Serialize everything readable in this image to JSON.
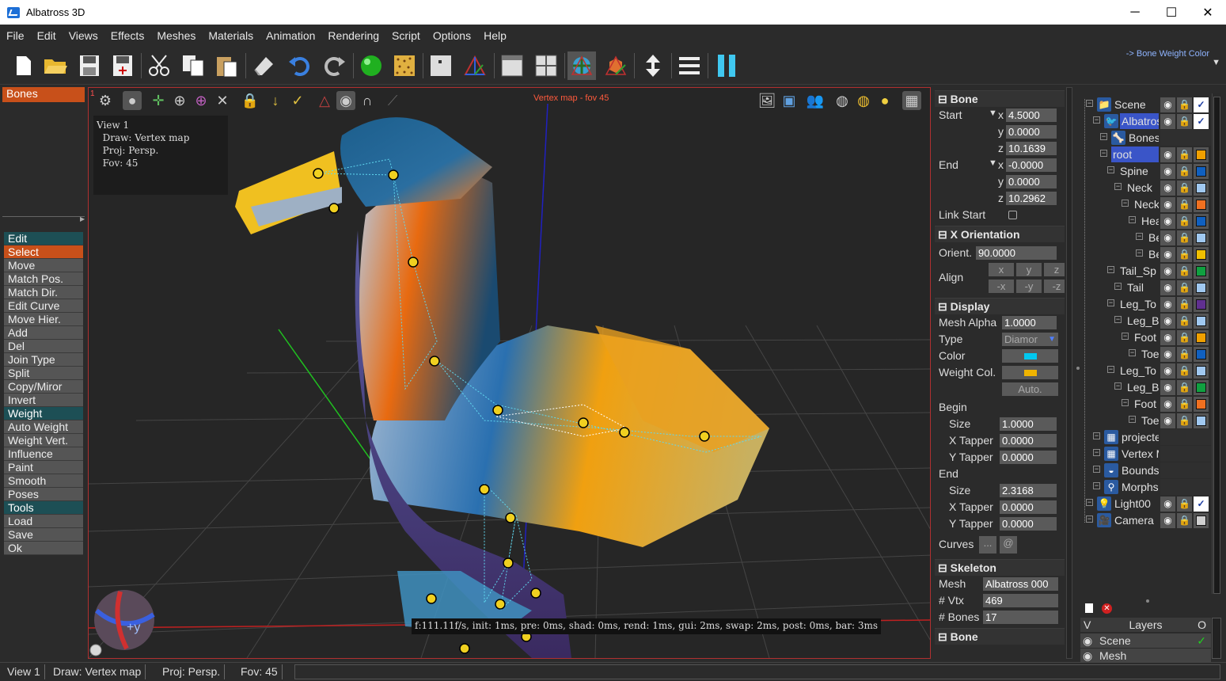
{
  "window": {
    "title": "Albatross 3D",
    "minimize": "─",
    "maximize": "☐",
    "close": "✕"
  },
  "menu": [
    "File",
    "Edit",
    "Views",
    "Effects",
    "Meshes",
    "Materials",
    "Animation",
    "Rendering",
    "Script",
    "Options",
    "Help"
  ],
  "toolbar": {
    "bone_weight_color": "-> Bone Weight Color",
    "dropdown": "▼"
  },
  "left_panel": {
    "header": "Bones",
    "items": [
      {
        "label": "Edit",
        "kind": "sec"
      },
      {
        "label": "Select",
        "kind": "sel"
      },
      {
        "label": "Move",
        "kind": ""
      },
      {
        "label": "Match Pos.",
        "kind": ""
      },
      {
        "label": "Match Dir.",
        "kind": ""
      },
      {
        "label": "Edit Curve",
        "kind": ""
      },
      {
        "label": "Move Hier.",
        "kind": ""
      },
      {
        "label": "Add",
        "kind": ""
      },
      {
        "label": "Del",
        "kind": ""
      },
      {
        "label": "Join Type",
        "kind": ""
      },
      {
        "label": "Split",
        "kind": ""
      },
      {
        "label": "Copy/Miror",
        "kind": ""
      },
      {
        "label": "Invert",
        "kind": ""
      },
      {
        "label": "Weight",
        "kind": "sec"
      },
      {
        "label": "Auto Weight",
        "kind": ""
      },
      {
        "label": "Weight Vert.",
        "kind": ""
      },
      {
        "label": "Influence",
        "kind": ""
      },
      {
        "label": "Paint",
        "kind": ""
      },
      {
        "label": "Smooth",
        "kind": ""
      },
      {
        "label": "Poses",
        "kind": ""
      },
      {
        "label": "Tools",
        "kind": "sec"
      },
      {
        "label": "Load",
        "kind": ""
      },
      {
        "label": "Save",
        "kind": ""
      },
      {
        "label": "Ok",
        "kind": ""
      }
    ]
  },
  "viewport": {
    "index": "1",
    "title": "Vertex map - fov 45",
    "info": [
      "View 1",
      "  Draw: Vertex map",
      "  Proj: Persp.",
      "  Fov: 45"
    ],
    "perf": "f:111.11f/s, init: 1ms, pre: 0ms, shad: 0ms, rend: 1ms, gui: 2ms, swap: 2ms, post: 0ms, bar: 3ms",
    "gizmo_label": "+y"
  },
  "bone": {
    "section": "Bone",
    "start_label": "Start",
    "end_label": "End",
    "x": "x",
    "y": "y",
    "z": "z",
    "start": {
      "x": "4.5000",
      "y": "0.0000",
      "z": "10.1639"
    },
    "end": {
      "x": "-0.0000",
      "y": "0.0000",
      "z": "10.2962"
    },
    "link_start": "Link Start"
  },
  "orientation": {
    "section": "X Orientation",
    "orient_label": "Orient.",
    "orient": "90.0000",
    "align_label": "Align",
    "buttons": [
      "x",
      "y",
      "z",
      "-x",
      "-y",
      "-z"
    ]
  },
  "display": {
    "section": "Display",
    "mesh_alpha_label": "Mesh Alpha",
    "mesh_alpha": "1.0000",
    "type_label": "Type",
    "type": "Diamor",
    "color_label": "Color",
    "color": "#00c8f0",
    "weight_col_label": "Weight Col.",
    "weight_col": "#f0b400",
    "auto": "Auto.",
    "begin_label": "Begin",
    "end_label": "End",
    "size_label": "Size",
    "xtap_label": "X Tapper",
    "ytap_label": "Y Tapper",
    "begin": {
      "size": "1.0000",
      "xtap": "0.0000",
      "ytap": "0.0000"
    },
    "end": {
      "size": "2.3168",
      "xtap": "0.0000",
      "ytap": "0.0000"
    },
    "curves_label": "Curves",
    "curves_a": "...",
    "curves_b": "@"
  },
  "skeleton": {
    "section": "Skeleton",
    "mesh_label": "Mesh",
    "mesh": "Albatross 000",
    "vtx_label": "# Vtx",
    "vtx": "469",
    "bones_label": "# Bones",
    "bones": "17",
    "next_section": "Bone"
  },
  "scene_tree": [
    {
      "label": "Scene",
      "indent": 0,
      "icon": "📁",
      "color": null,
      "check": true,
      "hl": false
    },
    {
      "label": "Albatross",
      "indent": 1,
      "icon": "🐦",
      "color": null,
      "check": true,
      "hl": true
    },
    {
      "label": "Bones",
      "indent": 2,
      "icon": "🦴",
      "color": null,
      "check": false,
      "hl": false,
      "nobtn": true
    },
    {
      "label": "root",
      "indent": 2,
      "icon": "",
      "color": "#f0a000",
      "check": false,
      "hl": true
    },
    {
      "label": "Spine",
      "indent": 3,
      "icon": "",
      "color": "#1060c0",
      "check": false,
      "hl": false
    },
    {
      "label": "Neck",
      "indent": 4,
      "icon": "",
      "color": "#a0c8f0",
      "check": false,
      "hl": false
    },
    {
      "label": "Neck",
      "indent": 5,
      "icon": "",
      "color": "#f07020",
      "check": false,
      "hl": false
    },
    {
      "label": "Head",
      "indent": 6,
      "icon": "",
      "color": "#1060c0",
      "check": false,
      "hl": false
    },
    {
      "label": "Beak",
      "indent": 7,
      "icon": "",
      "color": "#a0c8f0",
      "check": false,
      "hl": false
    },
    {
      "label": "Beak",
      "indent": 7,
      "icon": "",
      "color": "#f0c000",
      "check": false,
      "hl": false
    },
    {
      "label": "Tail_Sp",
      "indent": 3,
      "icon": "",
      "color": "#10a040",
      "check": false,
      "hl": false
    },
    {
      "label": "Tail",
      "indent": 4,
      "icon": "",
      "color": "#a0c8f0",
      "check": false,
      "hl": false
    },
    {
      "label": "Leg_To",
      "indent": 3,
      "icon": "",
      "color": "#603090",
      "check": false,
      "hl": false
    },
    {
      "label": "Leg_B",
      "indent": 4,
      "icon": "",
      "color": "#a0c8f0",
      "check": false,
      "hl": false
    },
    {
      "label": "Foot",
      "indent": 5,
      "icon": "",
      "color": "#f0a000",
      "check": false,
      "hl": false
    },
    {
      "label": "Toe",
      "indent": 6,
      "icon": "",
      "color": "#1060c0",
      "check": false,
      "hl": false
    },
    {
      "label": "Leg_To",
      "indent": 3,
      "icon": "",
      "color": "#a0c8f0",
      "check": false,
      "hl": false
    },
    {
      "label": "Leg_B",
      "indent": 4,
      "icon": "",
      "color": "#10a040",
      "check": false,
      "hl": false
    },
    {
      "label": "Foot",
      "indent": 5,
      "icon": "",
      "color": "#f07020",
      "check": false,
      "hl": false
    },
    {
      "label": "Toe",
      "indent": 6,
      "icon": "",
      "color": "#a0c8f0",
      "check": false,
      "hl": false
    },
    {
      "label": "projecte",
      "indent": 1,
      "icon": "▦",
      "color": null,
      "check": false,
      "hl": false,
      "nobtn": true
    },
    {
      "label": "Vertex M",
      "indent": 1,
      "icon": "▦",
      "color": null,
      "check": false,
      "hl": false,
      "nobtn": true
    },
    {
      "label": "Bounds",
      "indent": 1,
      "icon": "◒",
      "color": null,
      "check": false,
      "hl": false,
      "nobtn": true
    },
    {
      "label": "Morphs",
      "indent": 1,
      "icon": "⚲",
      "color": null,
      "check": false,
      "hl": false,
      "nobtn": true
    },
    {
      "label": "Light00",
      "indent": 0,
      "icon": "💡",
      "color": null,
      "check": true,
      "hl": false
    },
    {
      "label": "Camera",
      "indent": 0,
      "icon": "🎥",
      "color": "#d0d0d0",
      "check": false,
      "hl": false
    }
  ],
  "layers": {
    "v": "V",
    "title": "Layers",
    "o": "O",
    "rows": [
      {
        "name": "Scene",
        "check": "✓"
      },
      {
        "name": "Mesh",
        "check": ""
      }
    ]
  },
  "status": [
    "View 1",
    "Draw: Vertex map",
    "Proj: Persp.",
    "Fov: 45"
  ]
}
